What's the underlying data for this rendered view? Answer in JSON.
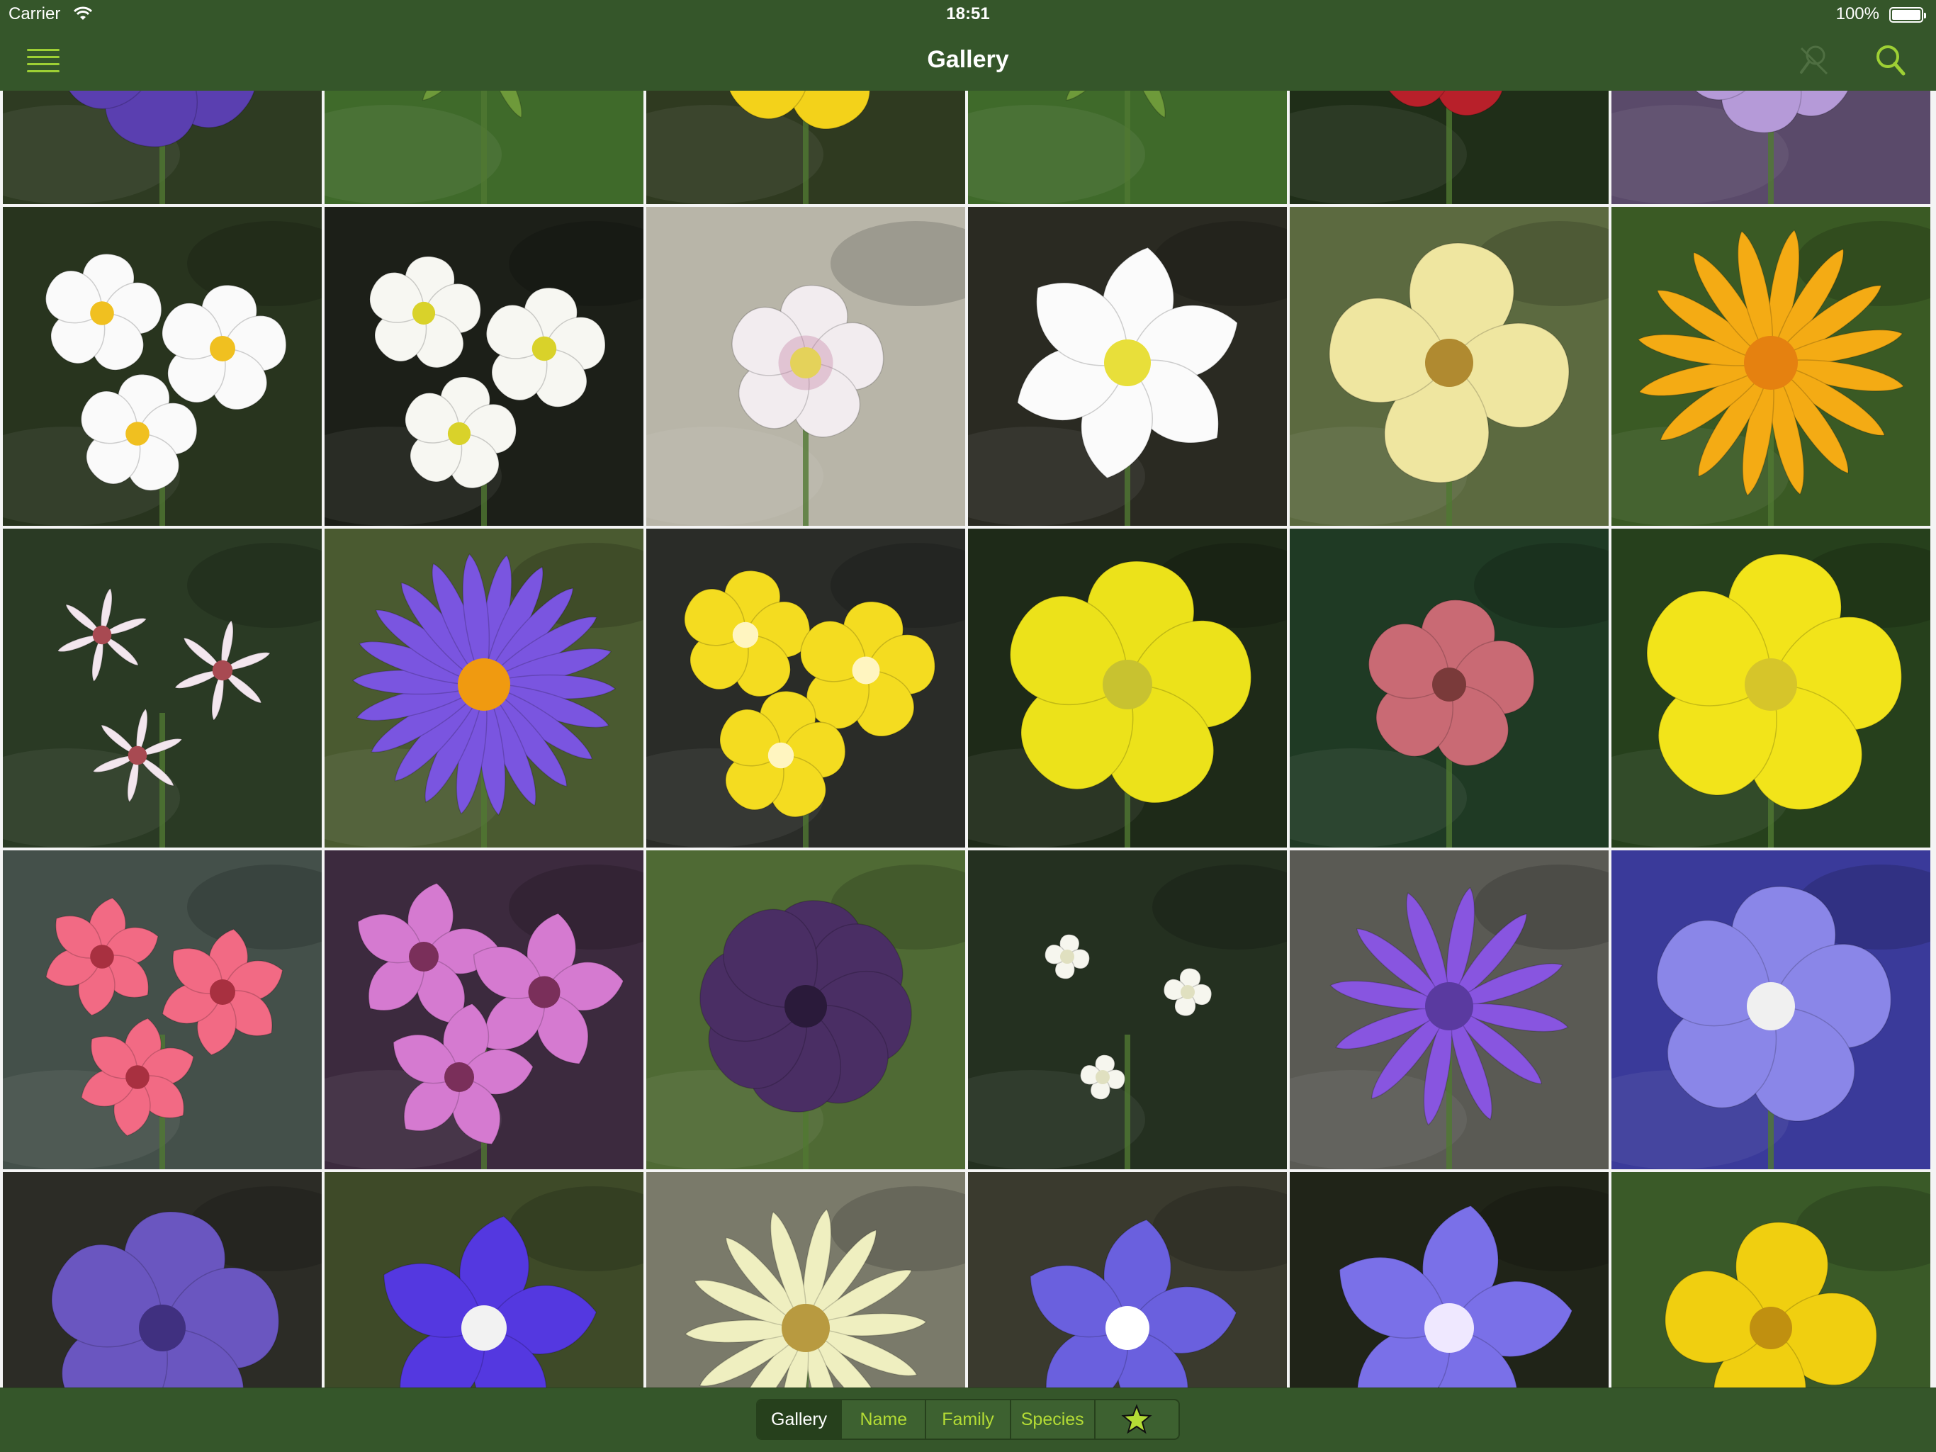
{
  "status_bar": {
    "carrier": "Carrier",
    "time": "18:51",
    "battery": "100%"
  },
  "nav_bar": {
    "title": "Gallery",
    "left_icon": "menu-icon",
    "right_icons": [
      "filter-off-icon",
      "search-icon"
    ]
  },
  "colors": {
    "bar_background": "#35562a",
    "accent": "#9ed034",
    "selected_segment": "#26401c"
  },
  "tab_bar": {
    "segments": [
      {
        "label": "Gallery",
        "selected": true
      },
      {
        "label": "Name",
        "selected": false
      },
      {
        "label": "Family",
        "selected": false
      },
      {
        "label": "Species",
        "selected": false
      },
      {
        "label": "",
        "icon": "star-icon",
        "selected": false
      }
    ]
  },
  "gallery": {
    "tiles": [
      {
        "flower": "purple"
      },
      {
        "flower": "green-foliage"
      },
      {
        "flower": "yellow"
      },
      {
        "flower": "green-foliage"
      },
      {
        "flower": "red"
      },
      {
        "flower": "lilac"
      },
      {
        "flower": "white-primula"
      },
      {
        "flower": "white-androsace"
      },
      {
        "flower": "white-pink-anemone"
      },
      {
        "flower": "white-wood-anemone"
      },
      {
        "flower": "pale-yellow-nettle"
      },
      {
        "flower": "orange-arnica"
      },
      {
        "flower": "white-asphodel"
      },
      {
        "flower": "purple-aster"
      },
      {
        "flower": "yellow-primula"
      },
      {
        "flower": "yellow-buttercup"
      },
      {
        "flower": "red-avens-bud"
      },
      {
        "flower": "yellow-potentilla"
      },
      {
        "flower": "pink-lily"
      },
      {
        "flower": "pink-stars"
      },
      {
        "flower": "dark-purple-bartsia"
      },
      {
        "flower": "white-bedstraw"
      },
      {
        "flower": "violet-spike"
      },
      {
        "flower": "blue-harebell"
      },
      {
        "flower": "purple-bellflower"
      },
      {
        "flower": "blue-bellflower"
      },
      {
        "flower": "cream-campanula"
      },
      {
        "flower": "blue-star-bellflower"
      },
      {
        "flower": "blue-star-bellflower-2"
      },
      {
        "flower": "yellow-pea"
      }
    ]
  }
}
